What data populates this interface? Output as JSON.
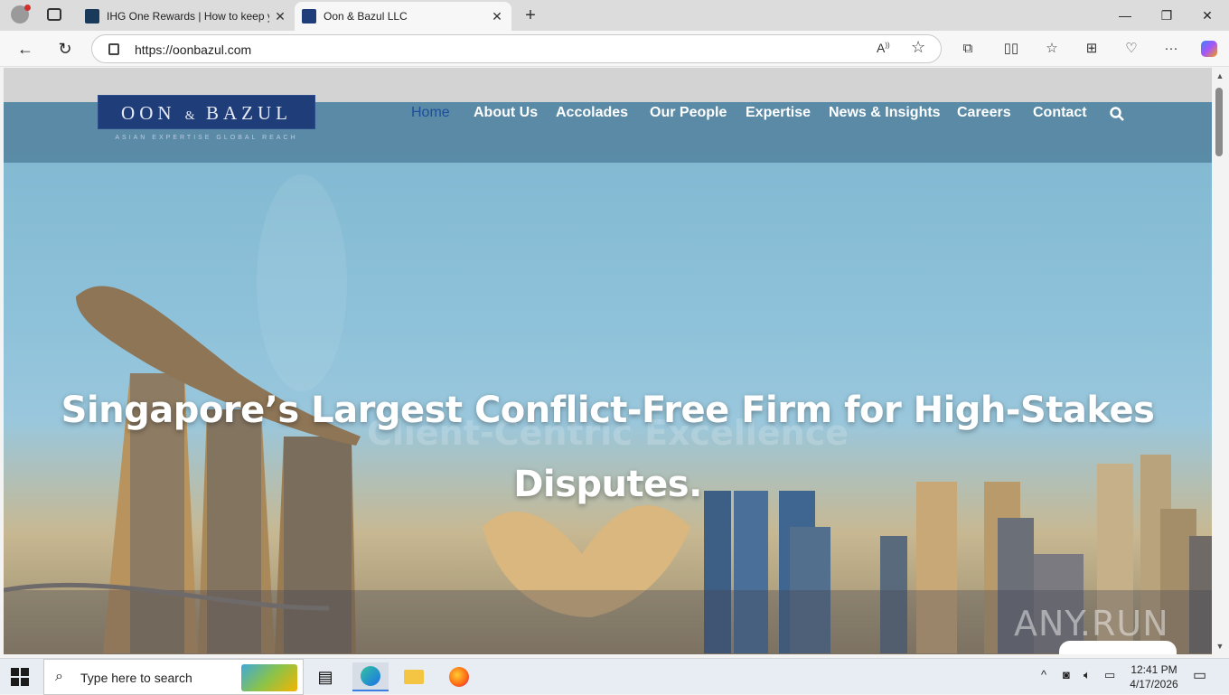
{
  "browser": {
    "tabs": [
      {
        "title": "IHG One Rewards | How to keep y",
        "favicon_color": "#1a3a5c",
        "active": false
      },
      {
        "title": "Oon & Bazul LLC",
        "favicon_color": "#1f3d78",
        "active": true
      }
    ],
    "url": "https://oonbazul.com",
    "icons": [
      "back-arrow-icon",
      "refresh-icon",
      "site-info-icon",
      "read-aloud-icon",
      "favorite-star-icon",
      "extensions-icon",
      "split-screen-icon",
      "favorites-icon",
      "collections-icon",
      "browser-essentials-icon",
      "more-icon",
      "copilot-icon"
    ]
  },
  "site": {
    "logo": {
      "main_left": "OON",
      "amp": "&",
      "main_right": "BAZUL",
      "tagline": "ASIAN EXPERTISE GLOBAL REACH"
    },
    "menu": [
      "Home",
      "About Us",
      "Accolades",
      "Our People",
      "Expertise",
      "News & Insights",
      "Careers",
      "Contact"
    ],
    "active_menu": "Home",
    "headline_line1": "Singapore’s Largest Conflict-Free Firm for High-Stakes",
    "headline_line2": "Disputes.",
    "ghost_text": "Client-Centric Excellence",
    "watermark": "ANY.RUN",
    "colors": {
      "nav_overlay": "#4b7896",
      "logo_bg": "#1f3d78",
      "active_menu": "#1d4f9a"
    }
  },
  "taskbar": {
    "search_placeholder": "Type here to search",
    "time": "12:41 PM",
    "date": "4/17/2026",
    "apps": [
      "task-view-icon",
      "edge-icon",
      "file-explorer-icon",
      "firefox-icon"
    ]
  }
}
